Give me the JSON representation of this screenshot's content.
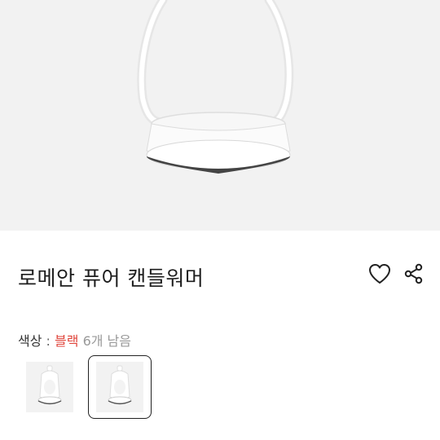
{
  "product": {
    "title": "로메안 퓨어 캔들워머",
    "hero_image": "white-lantern-candle-warmer"
  },
  "actions": {
    "like_icon": "heart-outline-icon",
    "share_icon": "share-icon"
  },
  "option": {
    "label": "색상",
    "separator": " : ",
    "value": "블랙",
    "stock": "6개 남음",
    "value_color": "#e0463c"
  },
  "thumbnails": [
    {
      "image": "white-lantern-thumbnail",
      "selected": false
    },
    {
      "image": "white-lantern-thumbnail",
      "selected": true
    }
  ]
}
